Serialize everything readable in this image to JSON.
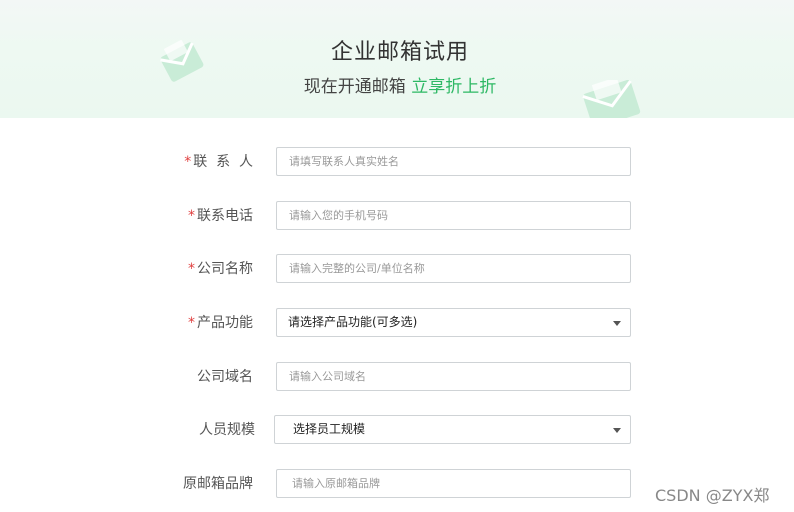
{
  "banner": {
    "title": "企业邮箱试用",
    "subtitle_prefix": "现在开通邮箱 ",
    "subtitle_highlight": "立享折上折"
  },
  "form": {
    "contact": {
      "label": "联  系  人",
      "required": "*",
      "placeholder": "请填写联系人真实姓名"
    },
    "phone": {
      "label": "联系电话",
      "required": "*",
      "placeholder": "请输入您的手机号码"
    },
    "company": {
      "label": "公司名称",
      "required": "*",
      "placeholder": "请输入完整的公司/单位名称"
    },
    "features": {
      "label": "产品功能",
      "required": "*",
      "selected": "请选择产品功能(可多选)"
    },
    "domain": {
      "label": "公司域名",
      "placeholder": "请输入公司域名"
    },
    "staff": {
      "label": "人员规模",
      "selected": "选择员工规模"
    },
    "brand": {
      "label": "原邮箱品牌",
      "placeholder": "请输入原邮箱品牌"
    }
  },
  "watermark": "CSDN @ZYX郑",
  "colors": {
    "accent": "#2db864",
    "required": "#e04040",
    "banner_bg": "#edf8f1"
  }
}
